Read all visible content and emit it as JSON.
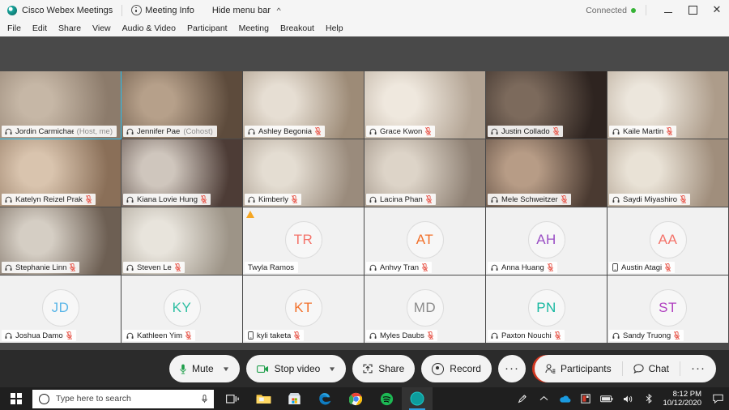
{
  "titlebar": {
    "app_title": "Cisco Webex Meetings",
    "meeting_info": "Meeting Info",
    "hide_menu_bar": "Hide menu bar",
    "connection_status": "Connected",
    "connection_color": "#36b336",
    "minimize": "minimize-icon",
    "maximize": "maximize-icon",
    "close": "close-icon"
  },
  "menubar": {
    "items": [
      "File",
      "Edit",
      "Share",
      "View",
      "Audio & Video",
      "Participant",
      "Meeting",
      "Breakout",
      "Help"
    ]
  },
  "stage": {
    "participants": [
      {
        "name": "Jordin Carmichael",
        "role": "(Host, me)",
        "type": "video",
        "icon": "headset-icon",
        "muted": false,
        "active": true,
        "warning": false,
        "bg1": "#c6b7a6",
        "bg2": "#8c7b6b"
      },
      {
        "name": "Jennifer Pae",
        "role": "(Cohost)",
        "type": "video",
        "icon": "headset-icon",
        "muted": false,
        "active": false,
        "warning": false,
        "bg1": "#b6a08a",
        "bg2": "#5d4b3c"
      },
      {
        "name": "Ashley Begonia",
        "role": "",
        "type": "video",
        "icon": "headset-icon",
        "muted": true,
        "active": false,
        "warning": false,
        "bg1": "#e6ded3",
        "bg2": "#9d8b77"
      },
      {
        "name": "Grace Kwon",
        "role": "",
        "type": "video",
        "icon": "headset-icon",
        "muted": true,
        "active": false,
        "warning": false,
        "bg1": "#efe8de",
        "bg2": "#b3a494"
      },
      {
        "name": "Justin Collado",
        "role": "",
        "type": "video",
        "icon": "headset-icon",
        "muted": true,
        "active": false,
        "warning": false,
        "bg1": "#7c6a5c",
        "bg2": "#2e2420"
      },
      {
        "name": "Kaile Martin",
        "role": "",
        "type": "video",
        "icon": "headset-icon",
        "muted": true,
        "active": false,
        "warning": false,
        "bg1": "#ece6dc",
        "bg2": "#ad9c8a"
      },
      {
        "name": "Katelyn Reizel Prak",
        "role": "",
        "type": "video",
        "icon": "headset-icon",
        "muted": true,
        "active": false,
        "warning": false,
        "bg1": "#d9c4ae",
        "bg2": "#8a6f58"
      },
      {
        "name": "Kiana Lovie Hung",
        "role": "",
        "type": "video",
        "icon": "headset-icon",
        "muted": true,
        "active": false,
        "warning": false,
        "bg1": "#cfc6bd",
        "bg2": "#4d3c36"
      },
      {
        "name": "Kimberly",
        "role": "",
        "type": "video",
        "icon": "headset-icon",
        "muted": true,
        "active": false,
        "warning": false,
        "bg1": "#e4ddd2",
        "bg2": "#9a8b7c"
      },
      {
        "name": "Lacina Phan",
        "role": "",
        "type": "video",
        "icon": "headset-icon",
        "muted": true,
        "active": false,
        "warning": false,
        "bg1": "#ddd4c8",
        "bg2": "#8e8073"
      },
      {
        "name": "Mele Schweitzer",
        "role": "",
        "type": "video",
        "icon": "headset-icon",
        "muted": true,
        "active": false,
        "warning": false,
        "bg1": "#b79c86",
        "bg2": "#4a3a31"
      },
      {
        "name": "Saydi Miyashiro",
        "role": "",
        "type": "video",
        "icon": "headset-icon",
        "muted": true,
        "active": false,
        "warning": false,
        "bg1": "#e9e2d6",
        "bg2": "#a08e7c"
      },
      {
        "name": "Stephanie Linn",
        "role": "",
        "type": "video",
        "icon": "headset-icon",
        "muted": true,
        "active": false,
        "warning": false,
        "bg1": "#d5cec4",
        "bg2": "#6d5f53"
      },
      {
        "name": "Steven Le",
        "role": "",
        "type": "video",
        "icon": "headset-icon",
        "muted": true,
        "active": false,
        "warning": false,
        "bg1": "#e8e4dc",
        "bg2": "#9d9487"
      },
      {
        "name": "Twyla Ramos",
        "role": "",
        "type": "avatar",
        "initials": "TR",
        "initials_color": "#f4736a",
        "icon": "none",
        "muted": false,
        "active": false,
        "warning": true
      },
      {
        "name": "Anhvy Tran",
        "role": "",
        "type": "avatar",
        "initials": "AT",
        "initials_color": "#f2702a",
        "icon": "headset-icon",
        "muted": true,
        "active": false,
        "warning": false
      },
      {
        "name": "Anna Huang",
        "role": "",
        "type": "avatar",
        "initials": "AH",
        "initials_color": "#9a4fc4",
        "icon": "headset-icon",
        "muted": true,
        "active": false,
        "warning": false
      },
      {
        "name": "Austin Atagi",
        "role": "",
        "type": "avatar",
        "initials": "AA",
        "initials_color": "#f4736a",
        "icon": "phone-icon",
        "muted": true,
        "active": false,
        "warning": false
      },
      {
        "name": "Joshua Damo",
        "role": "",
        "type": "avatar",
        "initials": "JD",
        "initials_color": "#5bb6e8",
        "icon": "headset-icon",
        "muted": true,
        "active": false,
        "warning": false
      },
      {
        "name": "Kathleen Yim",
        "role": "",
        "type": "avatar",
        "initials": "KY",
        "initials_color": "#2fbfa3",
        "icon": "headset-icon",
        "muted": true,
        "active": false,
        "warning": false
      },
      {
        "name": "kyli taketa",
        "role": "",
        "type": "avatar",
        "initials": "KT",
        "initials_color": "#f2702a",
        "icon": "phone-icon",
        "muted": true,
        "active": false,
        "warning": false
      },
      {
        "name": "Myles Daubs",
        "role": "",
        "type": "avatar",
        "initials": "MD",
        "initials_color": "#8a8a8a",
        "icon": "headset-icon",
        "muted": true,
        "active": false,
        "warning": false
      },
      {
        "name": "Paxton Nouchi",
        "role": "",
        "type": "avatar",
        "initials": "PN",
        "initials_color": "#17b8a0",
        "icon": "headset-icon",
        "muted": true,
        "active": false,
        "warning": false
      },
      {
        "name": "Sandy Truong",
        "role": "",
        "type": "avatar",
        "initials": "ST",
        "initials_color": "#b040c0",
        "icon": "headset-icon",
        "muted": true,
        "active": false,
        "warning": false
      }
    ]
  },
  "controls": {
    "mute": "Mute",
    "stop_video": "Stop video",
    "share": "Share",
    "record": "Record",
    "more": "···",
    "end": "×",
    "participants": "Participants",
    "chat": "Chat",
    "more_right": "···",
    "end_color": "#d1361f",
    "mic_color": "#1e9e4a"
  },
  "taskbar": {
    "search_placeholder": "Type here to search",
    "time": "8:12 PM",
    "date": "10/12/2020",
    "apps": [
      "task-view-icon",
      "file-explorer-icon",
      "microsoft-store-icon",
      "edge-icon",
      "chrome-icon",
      "spotify-icon",
      "webex-icon"
    ],
    "tray": [
      "pen-icon",
      "chevron-up-icon",
      "onedrive-icon",
      "security-icon",
      "battery-icon",
      "volume-icon",
      "bluetooth-icon"
    ]
  }
}
